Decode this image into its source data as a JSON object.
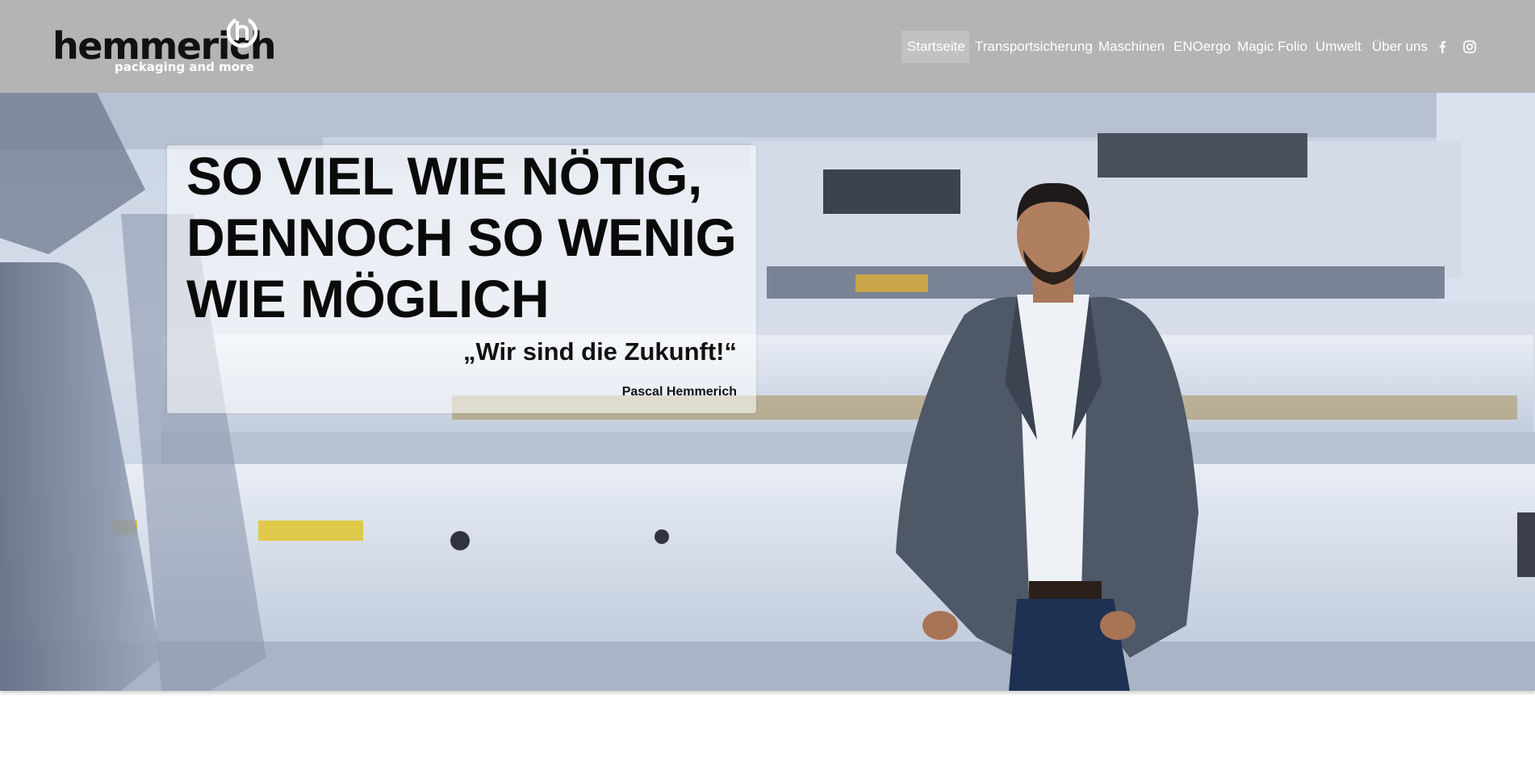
{
  "header": {
    "logo": {
      "wordmark": "hemmerich",
      "tagline": "packaging and more"
    },
    "nav": [
      {
        "label": "Startseite",
        "active": true
      },
      {
        "label": "Transportsicherung"
      },
      {
        "label": "Maschinen"
      },
      {
        "label": "ENOergo"
      },
      {
        "label": "Magic Folio"
      },
      {
        "label": "Umwelt"
      },
      {
        "label": "Über uns"
      }
    ],
    "social": [
      {
        "icon": "facebook-icon"
      },
      {
        "icon": "instagram-icon"
      }
    ]
  },
  "hero": {
    "headline_lines": [
      "SO VIEL WIE NÖTIG,",
      "DENNOCH SO WENIG",
      "WIE MÖGLICH"
    ],
    "quote": "„Wir sind die Zukunft!“",
    "author": "Pascal Hemmerich"
  },
  "colors": {
    "header_bg": "#b4b4b4",
    "active_nav_bg": "#c2c2c2",
    "nav_text": "#ffffff",
    "headline_text": "#0a0a0a"
  }
}
